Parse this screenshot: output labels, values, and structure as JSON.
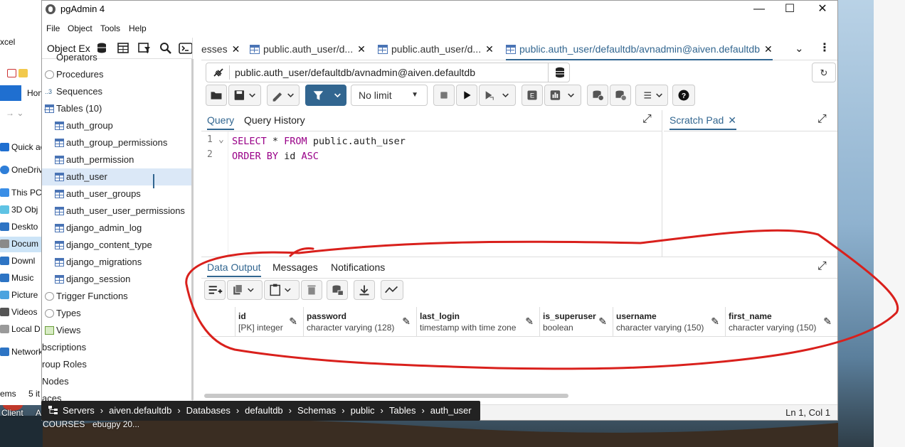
{
  "window": {
    "title": "pgAdmin 4",
    "minimize": "—",
    "maximize": "☐",
    "close": "✕"
  },
  "menu": [
    "File",
    "Object",
    "Tools",
    "Help"
  ],
  "object_explorer": {
    "title": "Object Ex",
    "top_cut_item": "Operators",
    "items": [
      {
        "label": "Procedures",
        "type": "folder"
      },
      {
        "label": "Sequences",
        "type": "seq"
      },
      {
        "label": "Tables (10)",
        "type": "tables",
        "arrow": "v"
      },
      {
        "label": "auth_group",
        "type": "table",
        "arrow": ">"
      },
      {
        "label": "auth_group_permissions",
        "type": "table",
        "arrow": ">"
      },
      {
        "label": "auth_permission",
        "type": "table",
        "arrow": ">"
      },
      {
        "label": "auth_user",
        "type": "table",
        "arrow": ">",
        "selected": true
      },
      {
        "label": "auth_user_groups",
        "type": "table",
        "arrow": ">"
      },
      {
        "label": "auth_user_user_permissions",
        "type": "table",
        "arrow": ">"
      },
      {
        "label": "django_admin_log",
        "type": "table",
        "arrow": ">"
      },
      {
        "label": "django_content_type",
        "type": "table",
        "arrow": ">"
      },
      {
        "label": "django_migrations",
        "type": "table",
        "arrow": ">"
      },
      {
        "label": "django_session",
        "type": "table",
        "arrow": ">"
      },
      {
        "label": "Trigger Functions",
        "type": "folder"
      },
      {
        "label": "Types",
        "type": "folder"
      },
      {
        "label": "Views",
        "type": "view"
      },
      {
        "label": "bscriptions",
        "type": "none"
      },
      {
        "label": "roup Roles",
        "type": "none"
      },
      {
        "label": "Nodes",
        "type": "none"
      },
      {
        "label": "aces",
        "type": "none"
      }
    ]
  },
  "tabs": [
    {
      "label": "esses",
      "active": false,
      "icon": false
    },
    {
      "label": "public.auth_user/d...",
      "active": false,
      "icon": true
    },
    {
      "label": "public.auth_user/d...",
      "active": false,
      "icon": true
    },
    {
      "label": "public.auth_user/defaultdb/avnadmin@aiven.defaultdb",
      "active": true,
      "icon": true
    }
  ],
  "tab_close": "✕",
  "connection": "public.auth_user/defaultdb/avnadmin@aiven.defaultdb",
  "limit_select": "No limit",
  "query_tabs": {
    "query": "Query",
    "history": "Query History",
    "scratch": "Scratch Pad"
  },
  "code_lines": [
    {
      "num": "1",
      "fold": "⌄",
      "parts": [
        [
          "kw",
          "SELECT"
        ],
        [
          "t",
          " * "
        ],
        [
          "kw",
          "FROM"
        ],
        [
          "t",
          " public.auth_user"
        ]
      ]
    },
    {
      "num": "2",
      "fold": "",
      "parts": [
        [
          "kw",
          "ORDER BY"
        ],
        [
          "t",
          " id "
        ],
        [
          "kw",
          "ASC"
        ]
      ]
    }
  ],
  "output_tabs": [
    "Data Output",
    "Messages",
    "Notifications"
  ],
  "columns": [
    {
      "name": "id",
      "type": "[PK] integer"
    },
    {
      "name": "password",
      "type": "character varying (128)"
    },
    {
      "name": "last_login",
      "type": "timestamp with time zone"
    },
    {
      "name": "is_superuser",
      "type": "boolean"
    },
    {
      "name": "username",
      "type": "character varying (150)"
    },
    {
      "name": "first_name",
      "type": "character varying (150)"
    }
  ],
  "status": {
    "cursor": "Ln 1, Col 1"
  },
  "breadcrumb": [
    "Servers",
    "aiven.defaultdb",
    "Databases",
    "defaultdb",
    "Schemas",
    "public",
    "Tables",
    "auth_user"
  ],
  "desktop": {
    "explorer_items": [
      "xcel",
      "Hon",
      "Quick ac",
      "OneDriv",
      "This PC",
      "3D Obj",
      "Deskto",
      "Docum",
      "Downl",
      "Music",
      "Picture",
      "Videos",
      "Local D",
      "Network",
      "ems",
      "5 it"
    ],
    "taskbar_labels": [
      "Client",
      "A",
      "COURSES",
      "ebugpy 20..."
    ]
  },
  "colors": {
    "accent": "#326690",
    "annotation": "#d9201c"
  }
}
